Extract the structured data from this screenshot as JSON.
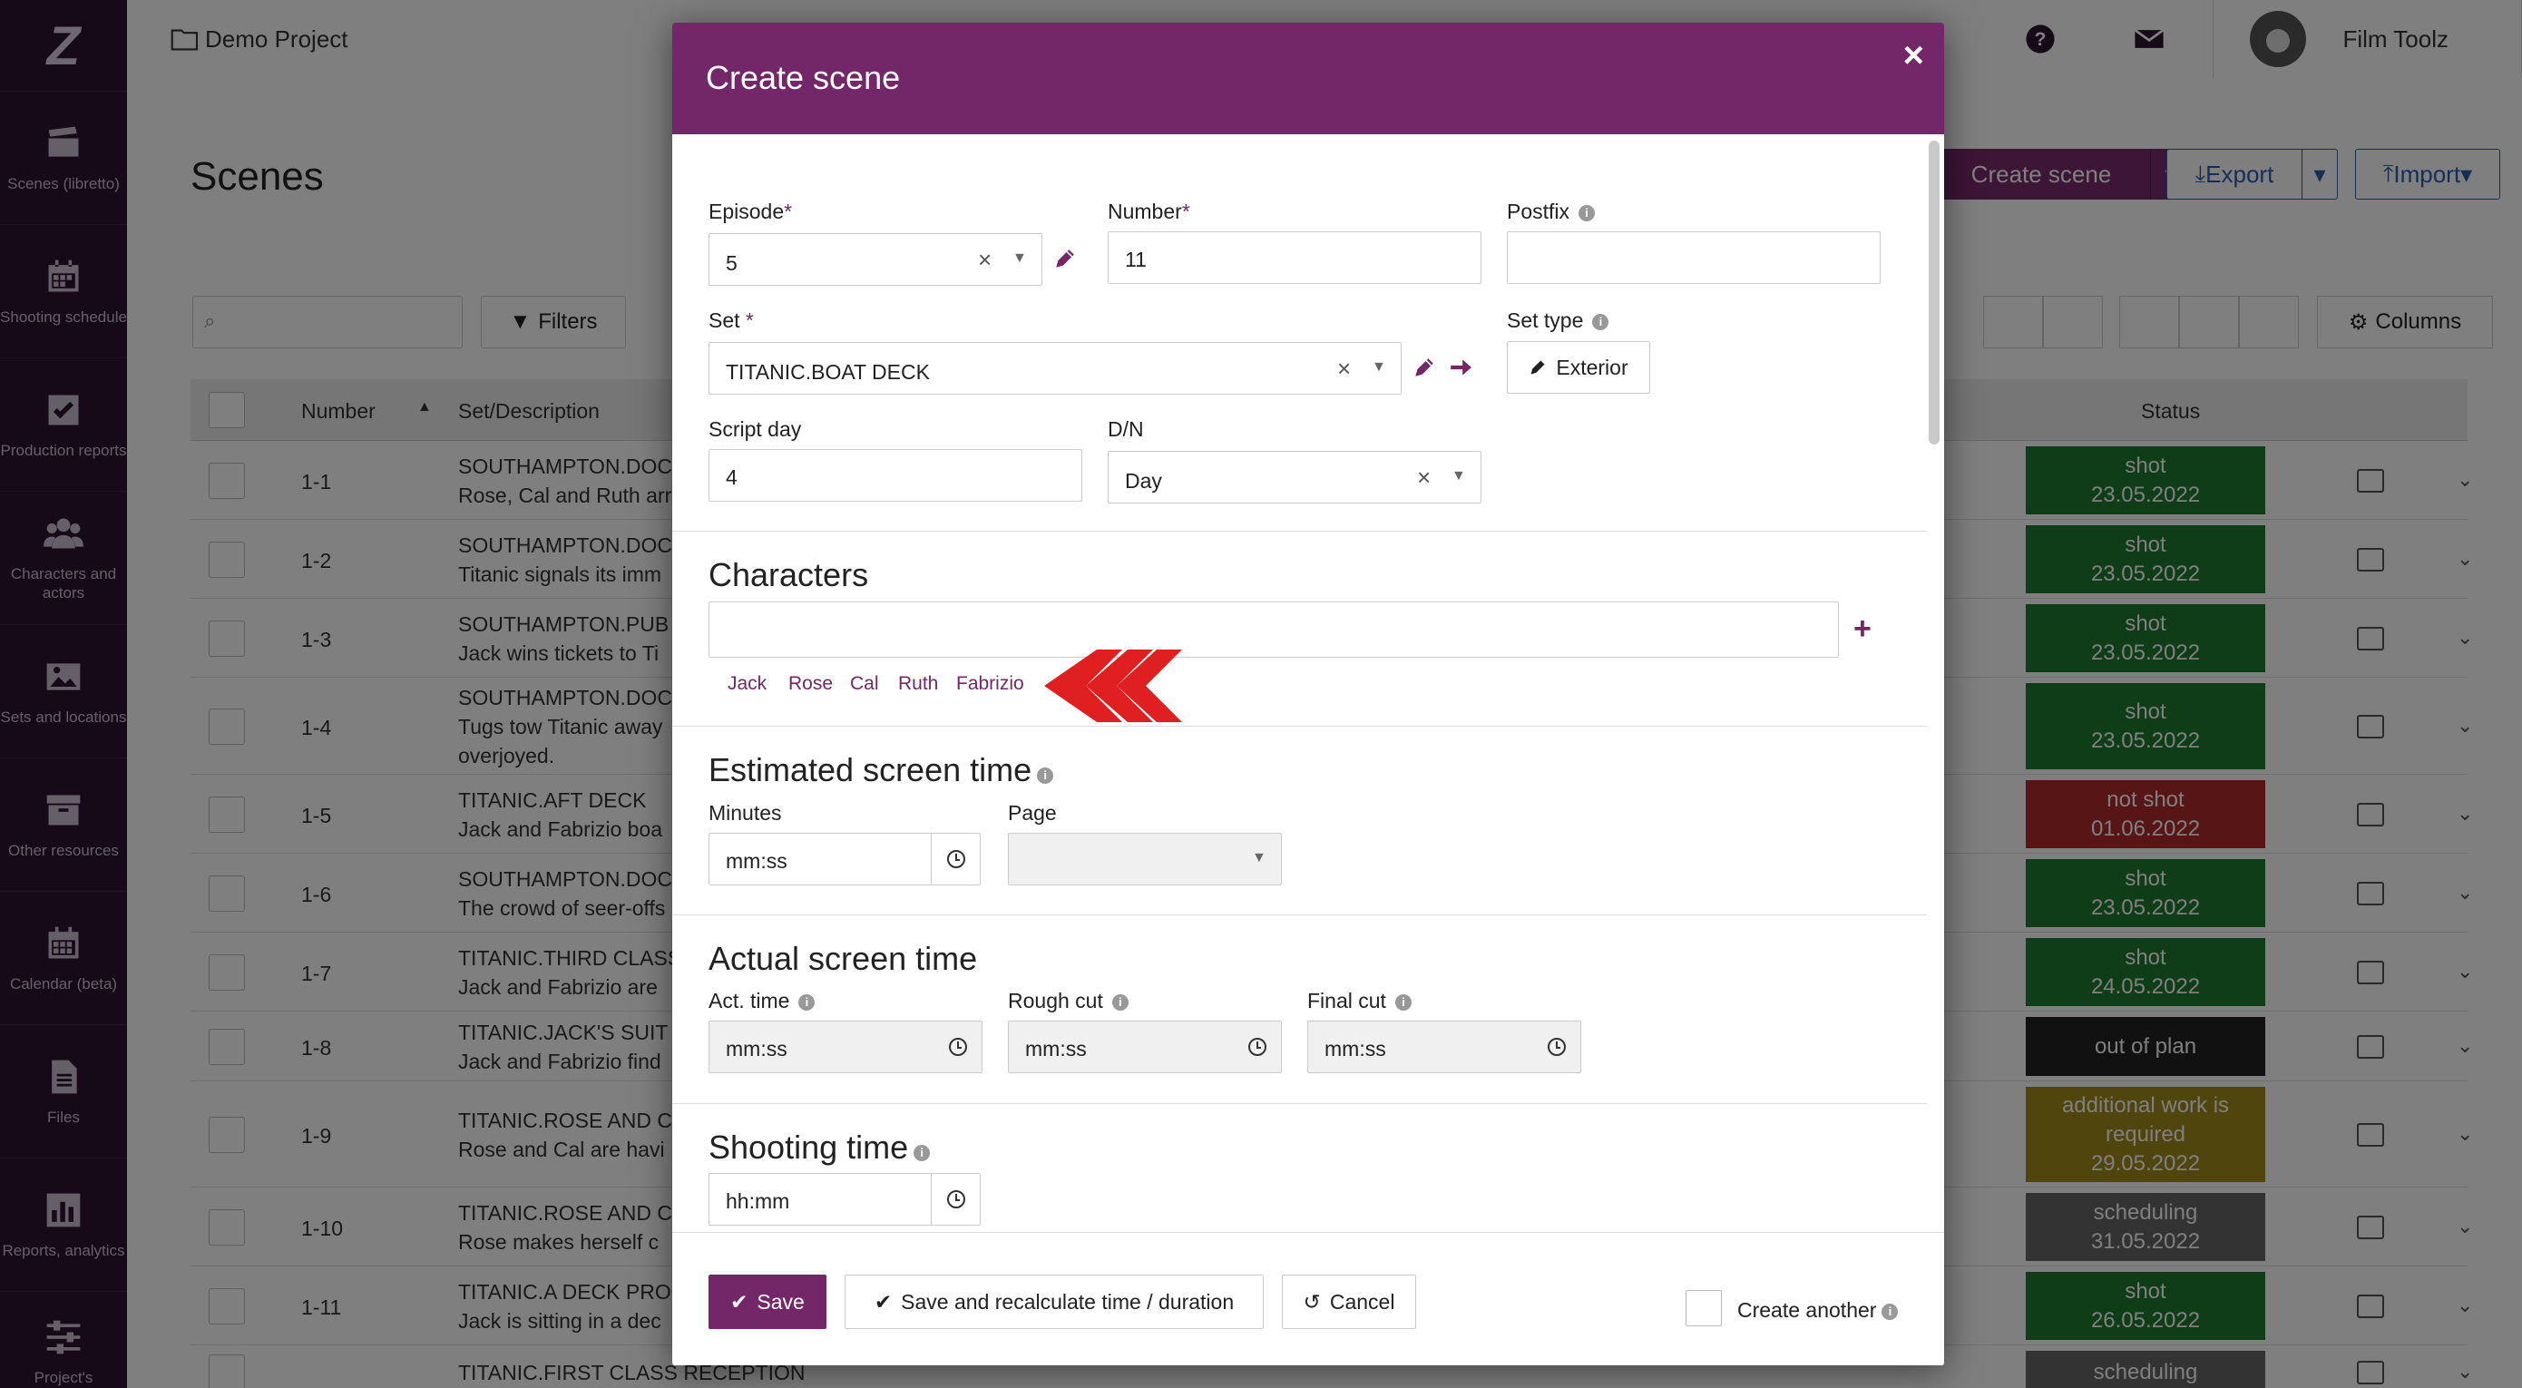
{
  "sidebar": {
    "items": [
      {
        "label": "Scenes (libretto)",
        "icon": "clapperboard-icon"
      },
      {
        "label": "Shooting schedule",
        "icon": "calendar-icon"
      },
      {
        "label": "Production reports",
        "icon": "checkbox-icon"
      },
      {
        "label": "Characters and actors",
        "icon": "people-icon"
      },
      {
        "label": "Sets and locations",
        "icon": "image-icon"
      },
      {
        "label": "Other resources",
        "icon": "archive-icon"
      },
      {
        "label": "Calendar (beta)",
        "icon": "calendar-grid-icon"
      },
      {
        "label": "Files",
        "icon": "file-icon"
      },
      {
        "label": "Reports, analytics",
        "icon": "bar-chart-icon"
      },
      {
        "label": "Project's",
        "icon": "sliders-icon"
      }
    ]
  },
  "topbar": {
    "project": "Demo Project",
    "user_name": "Film Toolz"
  },
  "page": {
    "title": "Scenes",
    "create_scene": "Create scene",
    "export": "Export",
    "import": "Import",
    "filters": "Filters",
    "columns": "Columns",
    "table_headers": {
      "number": "Number",
      "description": "Set/Description",
      "status": "Status"
    },
    "rows": [
      {
        "number": "1-1",
        "line1": "SOUTHAMPTON.DOC",
        "line2": "Rose, Cal and Ruth arr",
        "status1": "shot",
        "status2": "23.05.2022",
        "status3": "",
        "color": "#1e7a2e"
      },
      {
        "number": "1-2",
        "line1": "SOUTHAMPTON.DOC",
        "line2": "Titanic signals its imm",
        "status1": "shot",
        "status2": "23.05.2022",
        "status3": "",
        "color": "#1e7a2e"
      },
      {
        "number": "1-3",
        "line1": "SOUTHAMPTON.PUB",
        "line2": "Jack wins tickets to Ti",
        "status1": "shot",
        "status2": "23.05.2022",
        "status3": "",
        "color": "#1e7a2e"
      },
      {
        "number": "1-4",
        "line1": "SOUTHAMPTON.DOC",
        "line2": "Tugs tow Titanic away",
        "line3": "overjoyed.",
        "status1": "shot",
        "status2": "23.05.2022",
        "status3": "",
        "color": "#1e7a2e"
      },
      {
        "number": "1-5",
        "line1": "TITANIC.AFT DECK",
        "line2": "Jack and Fabrizio boa",
        "status1": "not shot",
        "status2": "01.06.2022",
        "status3": "",
        "color": "#b02a2a"
      },
      {
        "number": "1-6",
        "line1": "SOUTHAMPTON.DOC",
        "line2": "The crowd of seer-offs",
        "status1": "shot",
        "status2": "23.05.2022",
        "status3": "",
        "color": "#1e7a2e"
      },
      {
        "number": "1-7",
        "line1": "TITANIC.THIRD CLASS",
        "line2": "Jack and Fabrizio are",
        "status1": "shot",
        "status2": "24.05.2022",
        "status3": "",
        "color": "#1e7a2e"
      },
      {
        "number": "1-8",
        "line1": "TITANIC.JACK'S SUIT",
        "line2": "Jack and Fabrizio find",
        "status1": "out of plan",
        "status2": "",
        "status3": "",
        "color": "#222222"
      },
      {
        "number": "1-9",
        "line1": "TITANIC.ROSE AND C",
        "line2": "Rose and Cal are havi",
        "status1": "additional work is",
        "status2": "required",
        "status3": "29.05.2022",
        "color": "#a08a1a"
      },
      {
        "number": "1-10",
        "line1": "TITANIC.ROSE AND C",
        "line2": "Rose makes herself c",
        "status1": "scheduling",
        "status2": "31.05.2022",
        "status3": "",
        "color": "#666666"
      },
      {
        "number": "1-11",
        "line1": "TITANIC.A DECK PRO",
        "line2": "Jack is sitting in a dec",
        "status1": "shot",
        "status2": "26.05.2022",
        "status3": "",
        "color": "#1e7a2e"
      },
      {
        "number": "",
        "line1": "TITANIC.FIRST CLASS RECEPTION",
        "line2": "",
        "status1": "scheduling",
        "status2": "",
        "status3": "",
        "color": "#666666"
      }
    ]
  },
  "modal": {
    "title": "Create scene",
    "episode": {
      "label": "Episode",
      "required": "*",
      "value": "5"
    },
    "number": {
      "label": "Number",
      "required": "*",
      "value": "11"
    },
    "postfix": {
      "label": "Postfix",
      "value": ""
    },
    "set": {
      "label": "Set",
      "required": "*",
      "value": "TITANIC.BOAT DECK"
    },
    "set_type": {
      "label": "Set type",
      "value": "Exterior"
    },
    "script_day": {
      "label": "Script day",
      "value": "4"
    },
    "dn": {
      "label": "D/N",
      "value": "Day"
    },
    "characters": {
      "title": "Characters",
      "value": "",
      "suggestions": [
        "Jack",
        "Rose",
        "Cal",
        "Ruth",
        "Fabrizio"
      ]
    },
    "estimated": {
      "title": "Estimated screen time",
      "minutes_label": "Minutes",
      "minutes_placeholder": "mm:ss",
      "page_label": "Page",
      "page_value": ""
    },
    "actual": {
      "title": "Actual screen time",
      "act_label": "Act. time",
      "act_placeholder": "mm:ss",
      "rough_label": "Rough cut",
      "rough_placeholder": "mm:ss",
      "final_label": "Final cut",
      "final_placeholder": "mm:ss"
    },
    "shooting": {
      "title": "Shooting time",
      "placeholder": "hh:mm"
    },
    "footer": {
      "save": "Save",
      "save_recalc": "Save and recalculate time / duration",
      "cancel": "Cancel",
      "create_another": "Create another"
    }
  }
}
